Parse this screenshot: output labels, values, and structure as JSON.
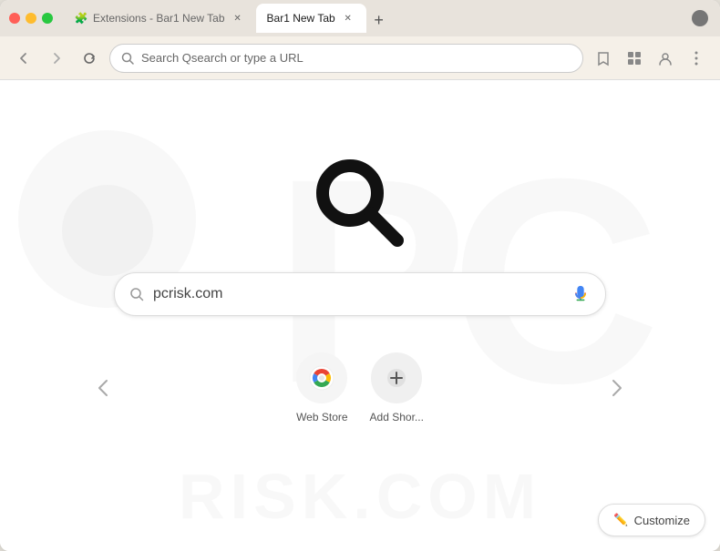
{
  "browser": {
    "tabs": [
      {
        "id": "tab-1",
        "label": "Extensions - Bar1 New Tab",
        "active": false,
        "favicon": "🧩"
      },
      {
        "id": "tab-2",
        "label": "Bar1 New Tab",
        "active": true,
        "favicon": ""
      }
    ],
    "new_tab_button": "+",
    "address_bar": {
      "placeholder": "Search Qsearch or type a URL",
      "url_text": "Search Qsearch or type a URL"
    },
    "nav": {
      "back": "‹",
      "forward": "›",
      "refresh": "↻"
    },
    "actions": {
      "bookmark": "☆",
      "extensions": "🧩",
      "profile": "👤",
      "menu": "⋮"
    }
  },
  "new_tab": {
    "search_value": "pcrisk.com",
    "search_placeholder": "Search Qsearch or type a URL",
    "shortcuts": [
      {
        "label": "Web Store",
        "icon_type": "rainbow"
      },
      {
        "label": "Add Shor...",
        "icon_type": "add"
      }
    ],
    "prev_arrow": "‹",
    "next_arrow": "›",
    "customize_label": "Customize",
    "customize_icon": "✏️"
  },
  "watermark": {
    "text": "PCRISK.COM"
  },
  "colors": {
    "background": "#ffffff",
    "tab_bar": "#e8e3dc",
    "address_bar": "#f5f0e8",
    "search_border": "#dddddd",
    "shortcut_bg": "#f5f5f5",
    "customize_border": "#dddddd",
    "accent_blue": "#4285f4"
  }
}
